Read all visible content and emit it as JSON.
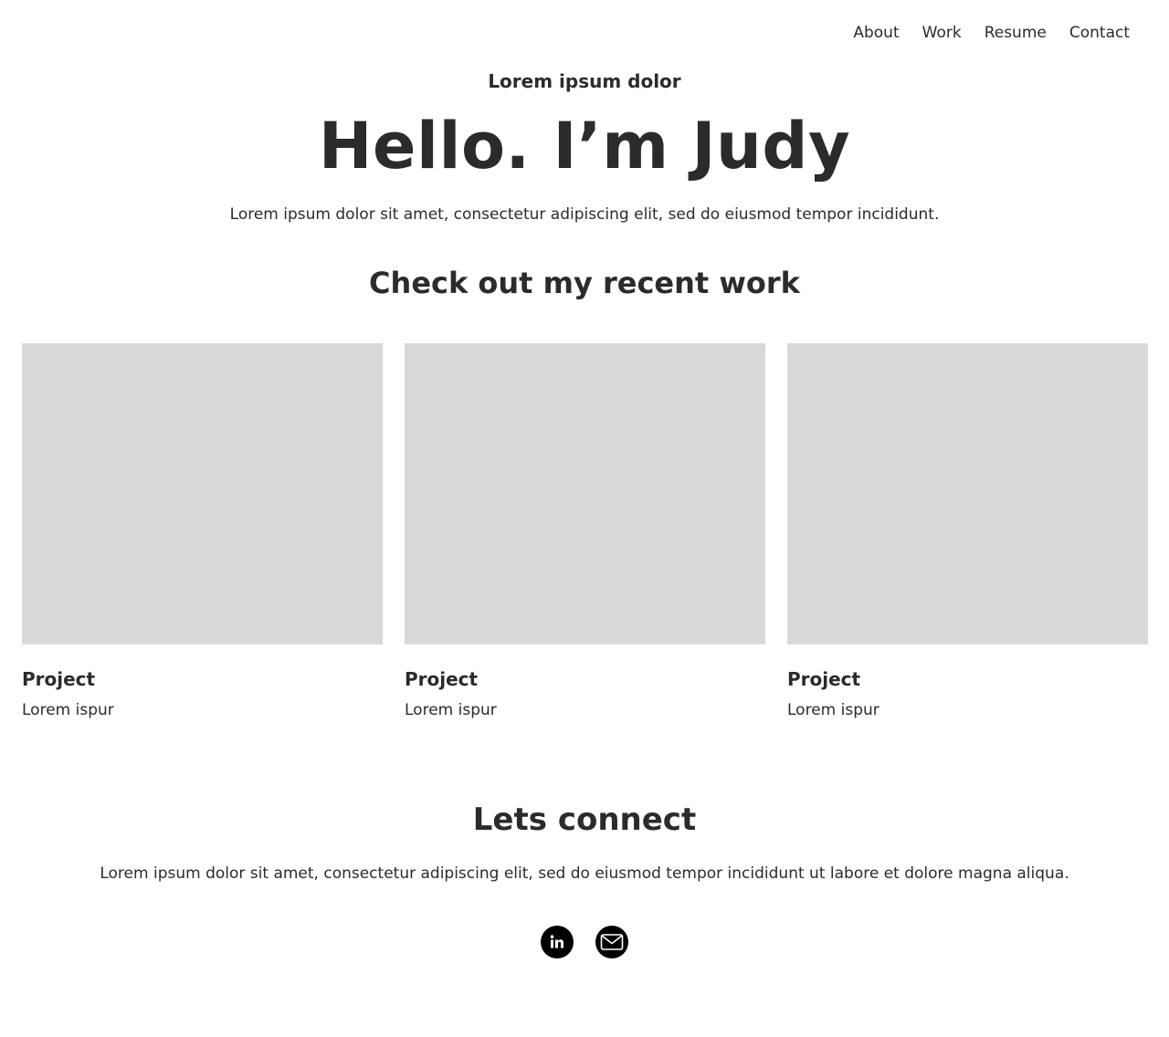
{
  "nav": {
    "items": [
      {
        "label": "About"
      },
      {
        "label": "Work"
      },
      {
        "label": "Resume"
      },
      {
        "label": "Contact"
      }
    ]
  },
  "hero": {
    "eyebrow": "Lorem ipsum dolor",
    "title": "Hello. I’m Judy",
    "subtitle": "Lorem ipsum dolor sit amet, consectetur adipiscing elit, sed do eiusmod tempor incididunt."
  },
  "work": {
    "title": "Check out my recent work",
    "projects": [
      {
        "title": "Project",
        "description": "Lorem ispur"
      },
      {
        "title": "Project",
        "description": "Lorem ispur"
      },
      {
        "title": "Project",
        "description": "Lorem ispur"
      }
    ]
  },
  "connect": {
    "title": "Lets connect",
    "subtitle": "Lorem ipsum dolor sit amet, consectetur adipiscing elit, sed do eiusmod tempor incididunt ut labore et dolore magna aliqua.",
    "links": [
      {
        "icon": "linkedin-icon"
      },
      {
        "icon": "mail-icon"
      }
    ]
  }
}
